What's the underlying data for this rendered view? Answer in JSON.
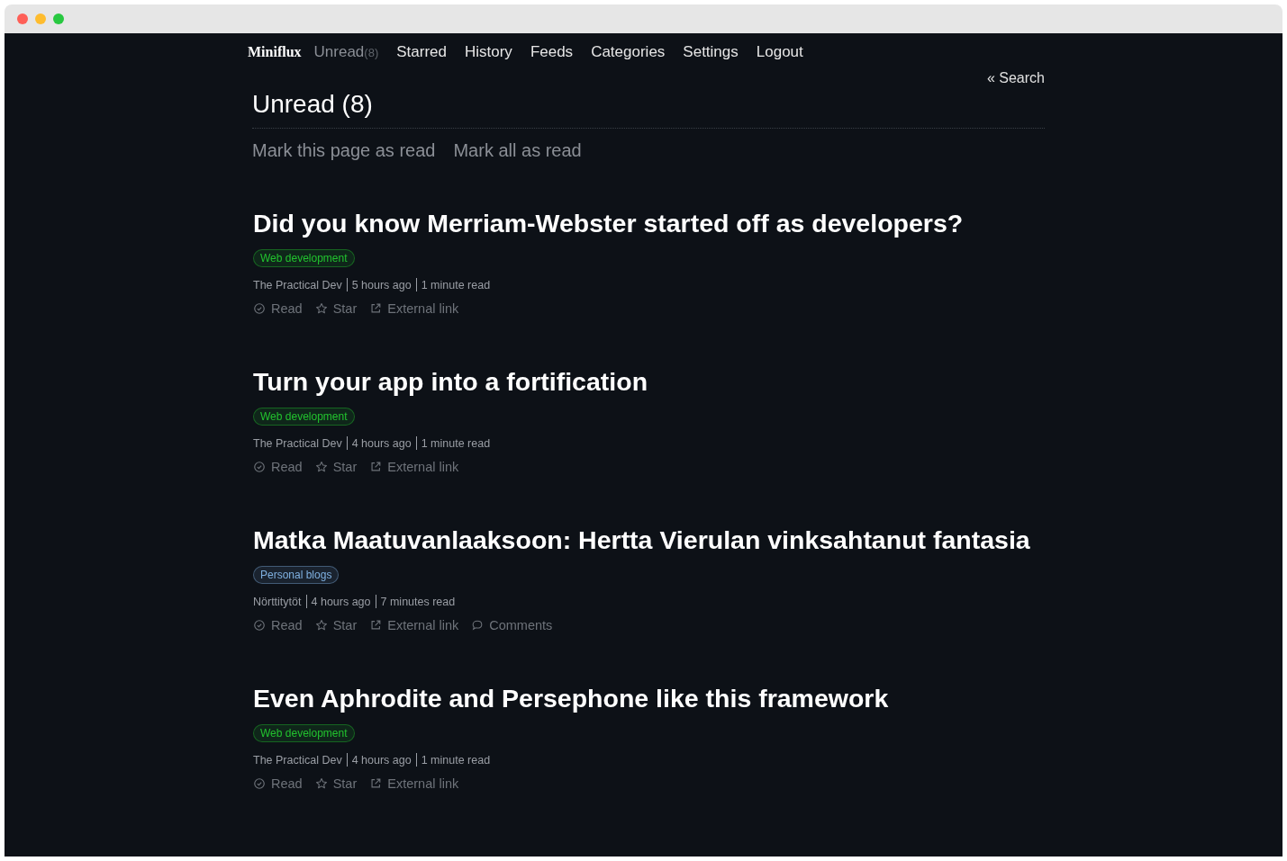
{
  "logo": "Miniflux",
  "nav": [
    {
      "label": "Unread",
      "count": "(8)",
      "selected": true
    },
    {
      "label": "Starred",
      "selected": false
    },
    {
      "label": "History",
      "selected": false
    },
    {
      "label": "Feeds",
      "selected": false
    },
    {
      "label": "Categories",
      "selected": false
    },
    {
      "label": "Settings",
      "selected": false
    },
    {
      "label": "Logout",
      "selected": false
    }
  ],
  "search_link": "« Search",
  "page_title": "Unread (8)",
  "page_actions": [
    "Mark this page as read",
    "Mark all as read"
  ],
  "entries": [
    {
      "title": "Did you know Merriam-Webster started off as developers?",
      "category": "Web development",
      "color": "#22c32e",
      "feed": "The Practical Dev",
      "time": "5 hours ago",
      "reading": "1 minute read",
      "actions": [
        {
          "kind": "read",
          "label": "Read"
        },
        {
          "kind": "star",
          "label": "Star"
        },
        {
          "kind": "external",
          "label": "External link"
        }
      ]
    },
    {
      "title": "Turn your app into a fortification",
      "category": "Web development",
      "color": "#22c32e",
      "feed": "The Practical Dev",
      "time": "4 hours ago",
      "reading": "1 minute read",
      "actions": [
        {
          "kind": "read",
          "label": "Read"
        },
        {
          "kind": "star",
          "label": "Star"
        },
        {
          "kind": "external",
          "label": "External link"
        }
      ]
    },
    {
      "title": "Matka Maatuvanlaaksoon: Hertta Vierulan vinksahtanut fantasia",
      "category": "Personal blogs",
      "color": "#7fb0e0",
      "feed": "Nörttitytöt",
      "time": "4 hours ago",
      "reading": "7 minutes read",
      "actions": [
        {
          "kind": "read",
          "label": "Read"
        },
        {
          "kind": "star",
          "label": "Star"
        },
        {
          "kind": "external",
          "label": "External link"
        },
        {
          "kind": "comments",
          "label": "Comments"
        }
      ]
    },
    {
      "title": "Even Aphrodite and Persephone like this framework",
      "category": "Web development",
      "color": "#22c32e",
      "feed": "The Practical Dev",
      "time": "4 hours ago",
      "reading": "1 minute read",
      "actions": [
        {
          "kind": "read",
          "label": "Read"
        },
        {
          "kind": "star",
          "label": "Star"
        },
        {
          "kind": "external",
          "label": "External link"
        }
      ]
    }
  ]
}
